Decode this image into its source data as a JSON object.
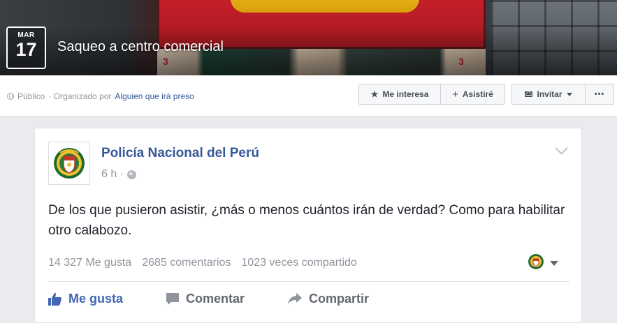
{
  "event": {
    "date_month": "MAR",
    "date_day": "17",
    "title": "Saqueo a centro comercial",
    "privacy": "Público",
    "organized_by_prefix": "· Organizado por",
    "organizer": "Alguien que irá preso",
    "cover_numbers": [
      "3",
      "3"
    ]
  },
  "actions_bar": {
    "interesa_label": "Me interesa",
    "asistire_label": "Asistiré",
    "invitar_label": "Invitar",
    "more_label": "•••"
  },
  "post": {
    "page_name": "Policía Nacional del Perú",
    "time": "6 h ·",
    "text": "De los que pusieron asistir, ¿más o menos cuántos irán de verdad? Como para habilitar otro calabozo.",
    "likes": "14 327 Me gusta",
    "comments": "2685 comentarios",
    "shares": "1023 veces compartido",
    "like_label": "Me gusta",
    "comment_label": "Comentar",
    "share_label": "Compartir"
  },
  "colors": {
    "link_blue": "#365899",
    "like_blue": "#4267b2",
    "muted_gray": "#90949c",
    "bg": "#e9ebee"
  },
  "icons": [
    "globe-icon",
    "star-icon",
    "plus-icon",
    "envelope-icon",
    "caret-down-icon",
    "more-icon",
    "chevron-down-icon",
    "thumbs-up-icon",
    "comment-icon",
    "share-arrow-icon"
  ]
}
